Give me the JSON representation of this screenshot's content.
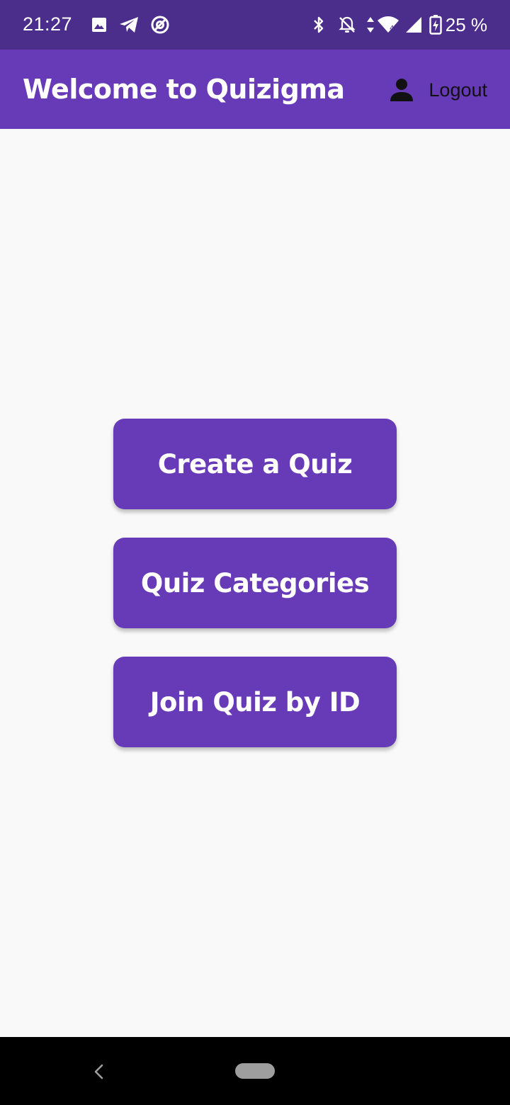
{
  "status_bar": {
    "time": "21:27",
    "battery_text": "25 %",
    "icons": [
      "image-icon",
      "telegram-icon",
      "at-sign-icon",
      "bluetooth-icon",
      "notifications-off-icon",
      "data-arrows-icon",
      "wifi-icon",
      "cellular-signal-icon",
      "battery-charging-icon"
    ]
  },
  "app_bar": {
    "title": "Welcome to Quizigma",
    "logout_label": "Logout",
    "user_icon": "person-icon"
  },
  "main": {
    "buttons": [
      {
        "label": "Create a Quiz"
      },
      {
        "label": "Quiz Categories"
      },
      {
        "label": "Join Quiz by ID"
      }
    ]
  },
  "nav_bar": {
    "back_icon": "back-chevron-icon",
    "home_icon": "home-pill-icon"
  },
  "colors": {
    "status_bar_bg": "#4b2d8b",
    "primary": "#673ab7",
    "background": "#f9f9f9",
    "nav_bar_bg": "#000000",
    "button_text": "#ffffff",
    "logout_text": "#111111"
  }
}
